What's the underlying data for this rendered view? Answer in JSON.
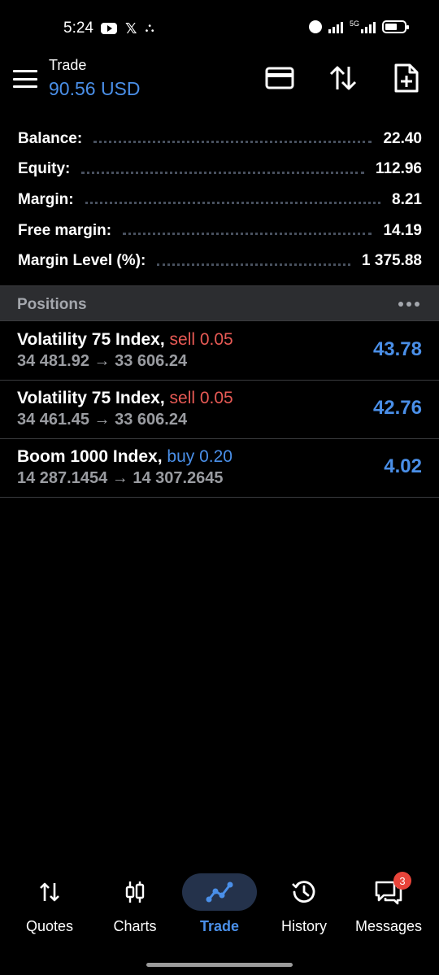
{
  "status_bar": {
    "time": "5:24",
    "net_label": "5G"
  },
  "header": {
    "title": "Trade",
    "balance": "90.56 USD"
  },
  "summary": [
    {
      "label": "Balance:",
      "value": "22.40"
    },
    {
      "label": "Equity:",
      "value": "112.96"
    },
    {
      "label": "Margin:",
      "value": "8.21"
    },
    {
      "label": "Free margin:",
      "value": "14.19"
    },
    {
      "label": "Margin Level (%):",
      "value": "1 375.88"
    }
  ],
  "positions": {
    "title": "Positions",
    "items": [
      {
        "symbol": "Volatility 75 Index,",
        "side": "sell 0.05",
        "prices": "34 481.92 → 33 606.24",
        "profit": "43.78"
      },
      {
        "symbol": "Volatility 75 Index,",
        "side": "sell 0.05",
        "prices": "34 461.45 → 33 606.24",
        "profit": "42.76"
      },
      {
        "symbol": "Boom 1000 Index,",
        "side": "buy 0.20",
        "prices": "14 287.1454 → 14 307.2645",
        "profit": "4.02"
      }
    ]
  },
  "nav": {
    "items": [
      {
        "label": "Quotes"
      },
      {
        "label": "Charts"
      },
      {
        "label": "Trade"
      },
      {
        "label": "History"
      },
      {
        "label": "Messages",
        "badge": "3"
      }
    ],
    "active": "Trade"
  },
  "colors": {
    "accent": "#4a8fe8",
    "sell": "#e85a55",
    "badge": "#e8443a",
    "background": "#000000"
  }
}
